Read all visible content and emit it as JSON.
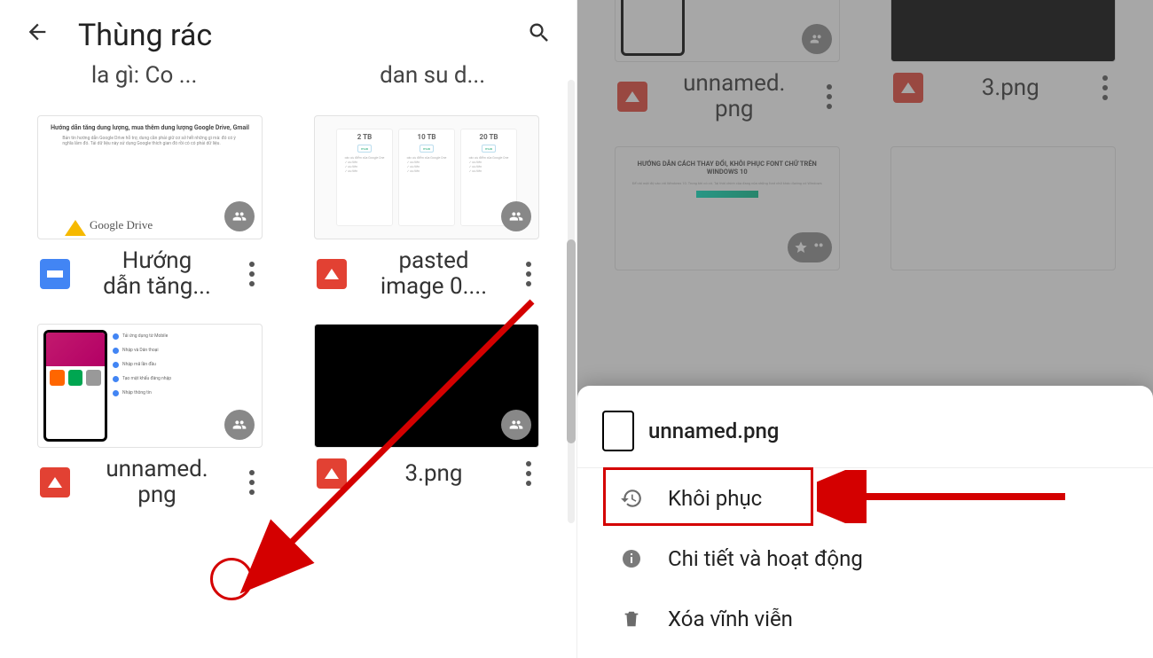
{
  "left": {
    "header": {
      "title": "Thùng rác"
    },
    "cutoff_labels": {
      "a": "la gì: Co ...",
      "b": "dan su d..."
    },
    "files": [
      {
        "name": "Hướng\ndẫn tăng...",
        "type": "docs"
      },
      {
        "name": "pasted\nimage 0....",
        "type": "img"
      },
      {
        "name": "unnamed.\npng",
        "type": "img"
      },
      {
        "name": "3.png",
        "type": "img"
      }
    ],
    "thumb_doc_header": "Hướng dẫn tăng dung lượng, mua thêm dung lượng Google Drive, Gmail",
    "gdrive_label": "Google Drive",
    "plans": [
      "2 TB",
      "10 TB",
      "20 TB"
    ],
    "thumb_text_header": "HƯỚNG DẪN CÁCH THAY ĐỔI, KHÔI PHỤC FONT CHỮ TRÊN WINDOWS 10"
  },
  "right": {
    "bg_files": [
      {
        "name": "unnamed.\npng",
        "type": "img"
      },
      {
        "name": "3.png",
        "type": "img"
      }
    ],
    "sheet": {
      "filename": "unnamed.png",
      "items": {
        "restore": "Khôi phục",
        "details": "Chi tiết và hoạt động",
        "delete": "Xóa vĩnh viễn"
      }
    }
  }
}
